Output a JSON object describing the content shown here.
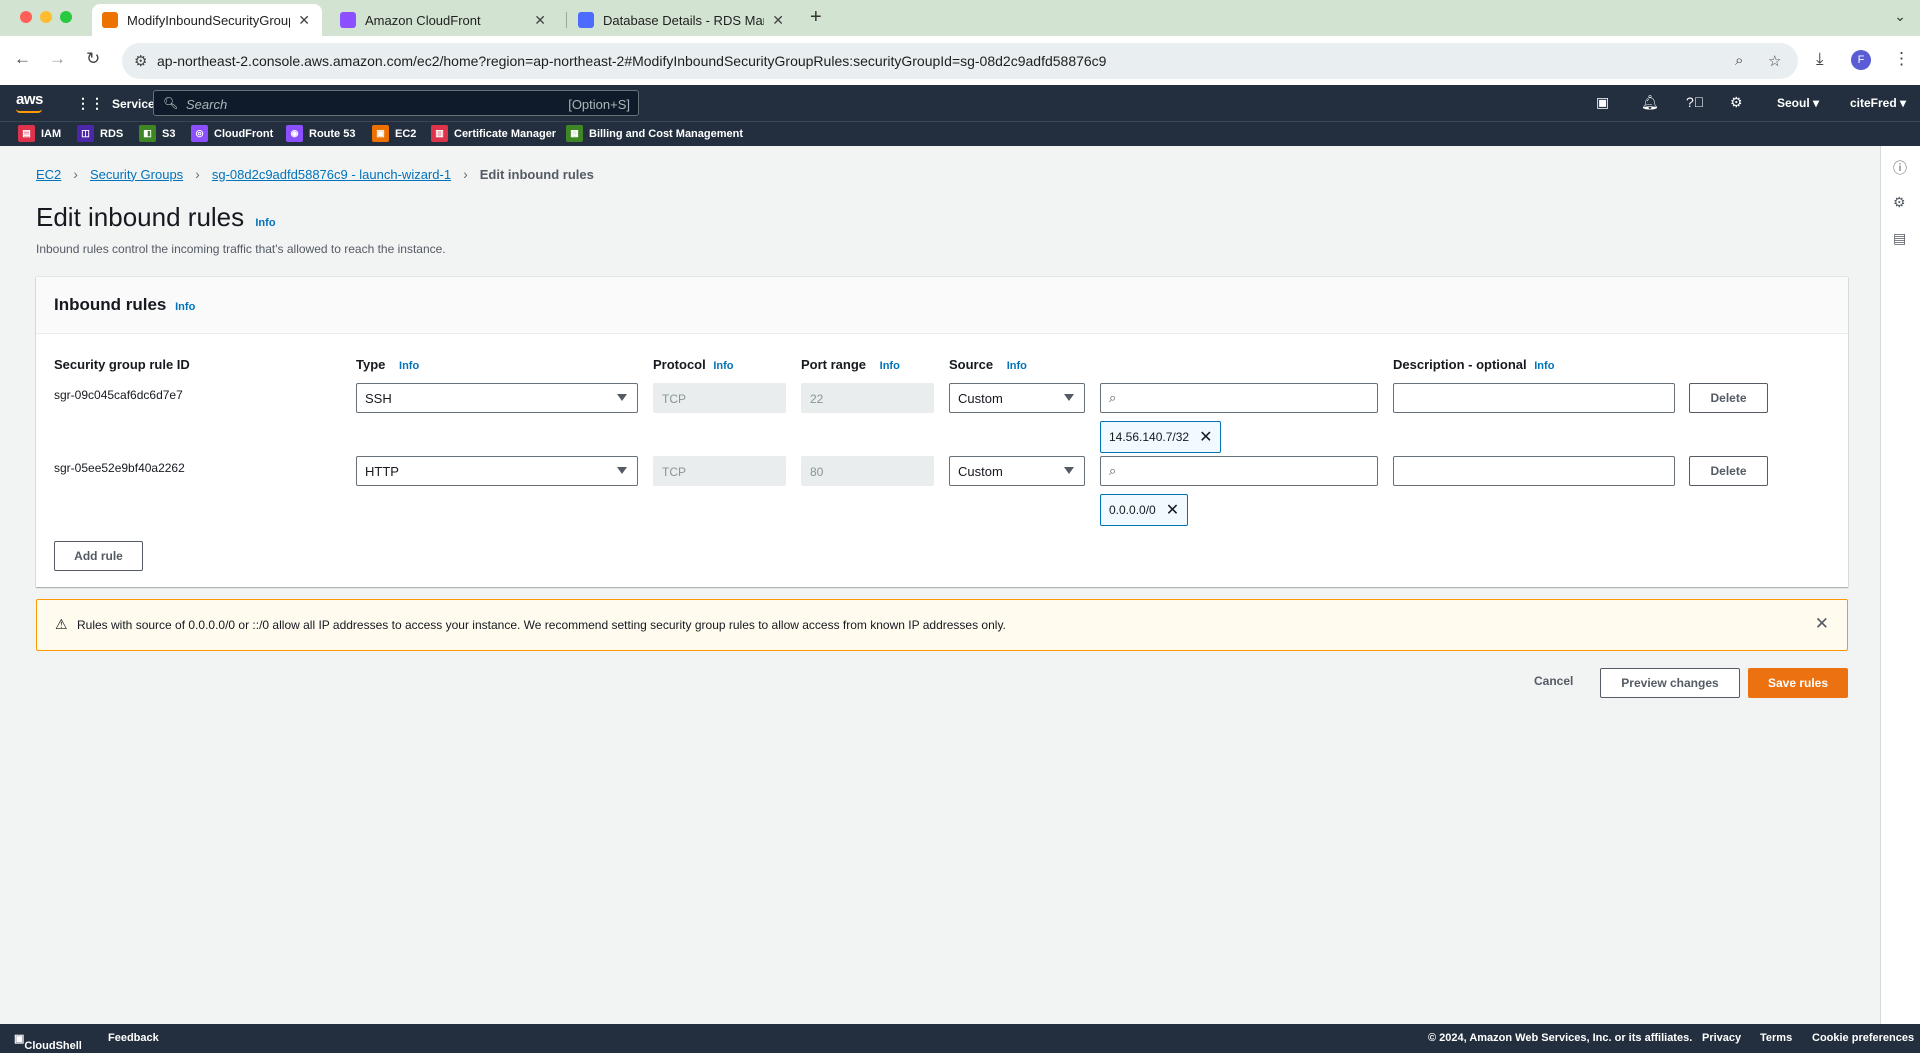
{
  "browser": {
    "tabs": [
      {
        "title": "ModifyInboundSecurityGroupRules",
        "active": true
      },
      {
        "title": "Amazon CloudFront",
        "active": false
      },
      {
        "title": "Database Details - RDS Management Console",
        "active": false
      }
    ],
    "url": "ap-northeast-2.console.aws.amazon.com/ec2/home?region=ap-northeast-2#ModifyInboundSecurityGroupRules:securityGroupId=sg-08d2c9adfd58876c9",
    "profile_initial": "F"
  },
  "header": {
    "logo": "aws",
    "services_label": "Services",
    "search_placeholder": "Search",
    "search_shortcut": "[Option+S]",
    "region": "Seoul",
    "account": "citeFred"
  },
  "favorites": [
    {
      "label": "IAM",
      "color": "#dd344c"
    },
    {
      "label": "RDS",
      "color": "#4d27aa"
    },
    {
      "label": "S3",
      "color": "#3f8624"
    },
    {
      "label": "CloudFront",
      "color": "#8c4fff"
    },
    {
      "label": "Route 53",
      "color": "#8c4fff"
    },
    {
      "label": "EC2",
      "color": "#ed7100"
    },
    {
      "label": "Certificate Manager",
      "color": "#dd344c"
    },
    {
      "label": "Billing and Cost Management",
      "color": "#3f8624"
    }
  ],
  "breadcrumb": {
    "items": [
      "EC2",
      "Security Groups",
      "sg-08d2c9adfd58876c9 - launch-wizard-1"
    ],
    "current": "Edit inbound rules"
  },
  "page": {
    "title": "Edit inbound rules",
    "info": "Info",
    "subtitle": "Inbound rules control the incoming traffic that's allowed to reach the instance."
  },
  "panel": {
    "title": "Inbound rules",
    "info": "Info",
    "columns": {
      "rule_id": "Security group rule ID",
      "type": "Type",
      "protocol": "Protocol",
      "port_range": "Port range",
      "source": "Source",
      "description": "Description - optional"
    },
    "rules": [
      {
        "id": "sgr-09c045caf6dc6d7e7",
        "type": "SSH",
        "protocol": "TCP",
        "port": "22",
        "source": "Custom",
        "cidr": "14.56.140.7/32",
        "description": ""
      },
      {
        "id": "sgr-05ee52e9bf40a2262",
        "type": "HTTP",
        "protocol": "TCP",
        "port": "80",
        "source": "Custom",
        "cidr": "0.0.0.0/0",
        "description": ""
      }
    ],
    "delete_label": "Delete",
    "add_rule_label": "Add rule"
  },
  "warning": {
    "text": "Rules with source of 0.0.0.0/0 or ::/0 allow all IP addresses to access your instance. We recommend setting security group rules to allow access from known IP addresses only."
  },
  "actions": {
    "cancel": "Cancel",
    "preview": "Preview changes",
    "save": "Save rules"
  },
  "footer": {
    "cloudshell": "CloudShell",
    "feedback": "Feedback",
    "copyright": "© 2024, Amazon Web Services, Inc. or its affiliates.",
    "privacy": "Privacy",
    "terms": "Terms",
    "cookies": "Cookie preferences"
  },
  "colors": {
    "accent": "#0073bb",
    "primary_button": "#ec7211",
    "warning_border": "#ff9900",
    "header": "#232f3e"
  }
}
